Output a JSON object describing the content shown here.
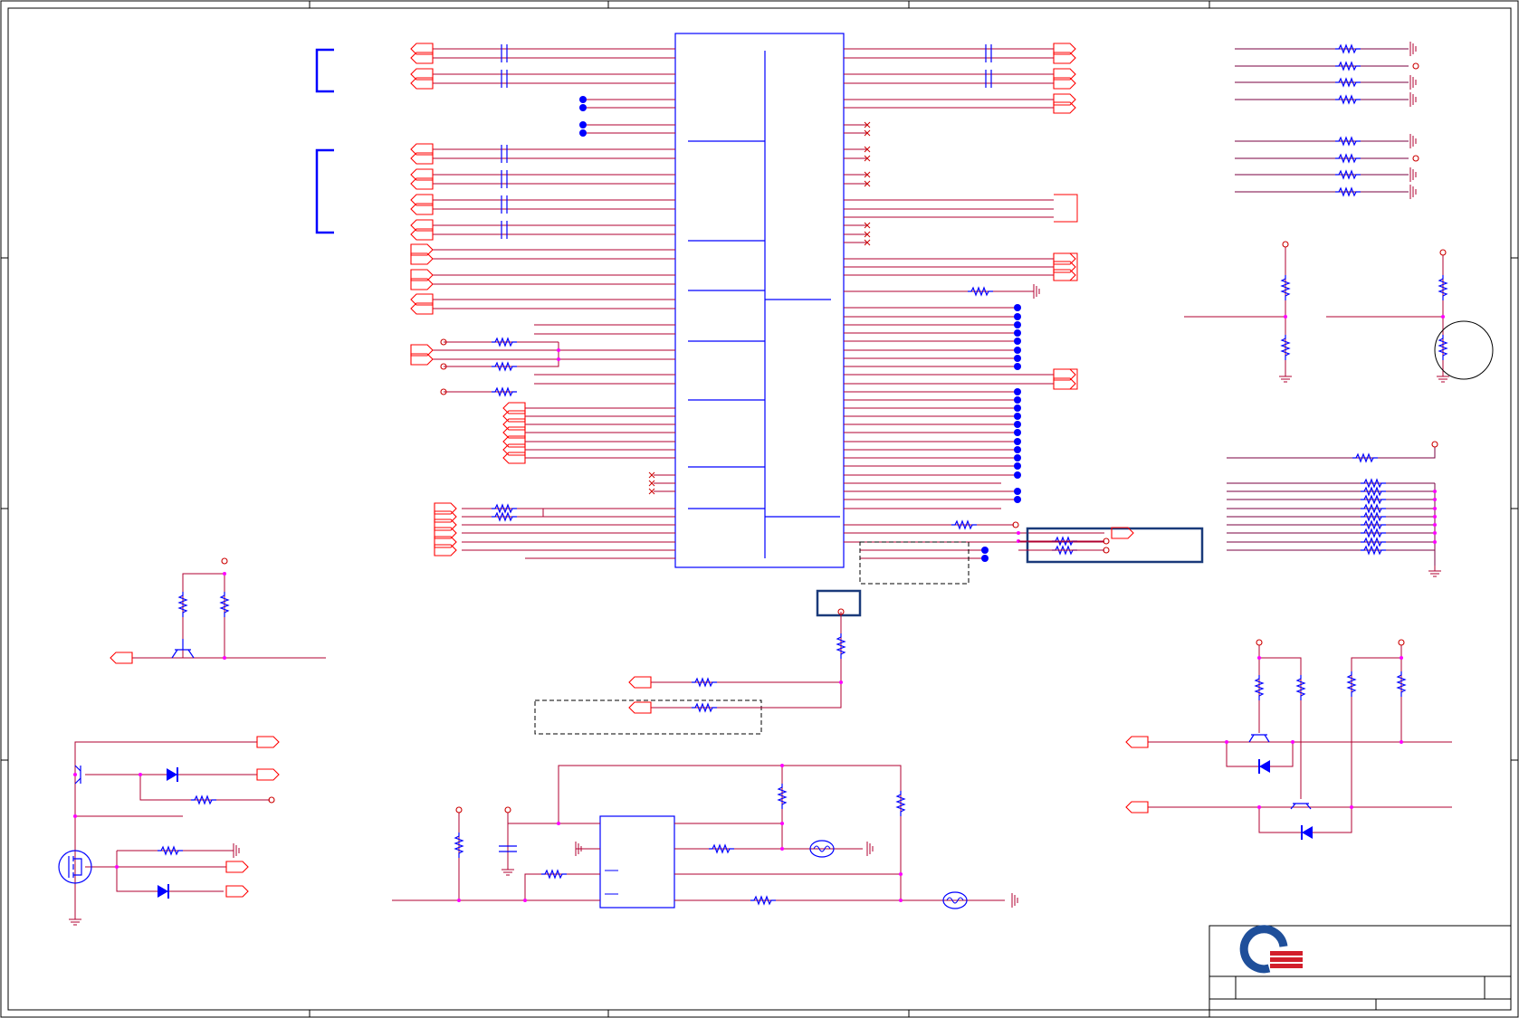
{
  "diagram": {
    "type": "electronic-schematic",
    "colors": {
      "wire": "#b00030",
      "wire_alt": "#7a0040",
      "component": "#0000ff",
      "connector": "#ff0000",
      "junction": "#ff00ff",
      "border": "#000000",
      "highlight_box": "#1a3a7a",
      "logo_blue": "#1f4f9a",
      "logo_red": "#d21e2b"
    },
    "icons": {
      "logo": "quanta-style-logo",
      "title_block": "title-block"
    },
    "labels": []
  }
}
